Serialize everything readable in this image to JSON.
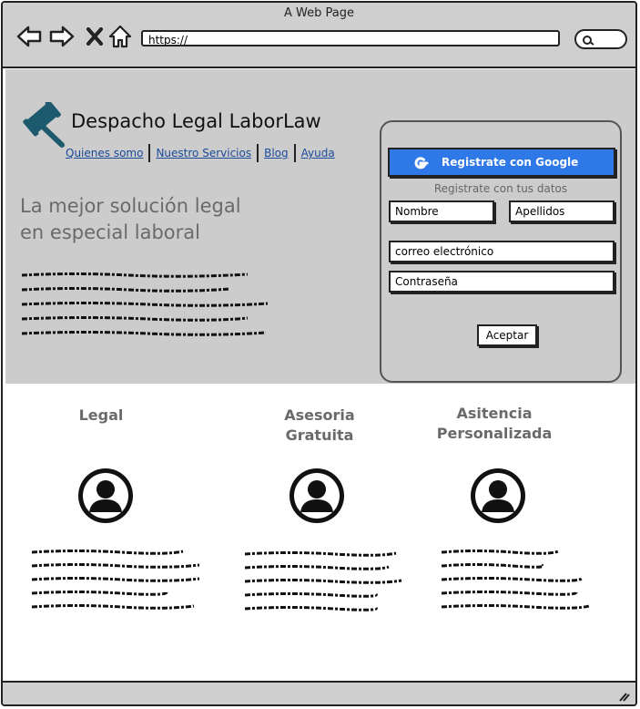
{
  "window": {
    "title": "A Web Page"
  },
  "browser": {
    "url": "https://",
    "icons": [
      "back-arrow-icon",
      "forward-arrow-icon",
      "close-x-icon",
      "home-icon",
      "search-icon"
    ]
  },
  "header": {
    "brand": "Despacho Legal LaborLaw",
    "logo_icon": "gavel-icon",
    "nav": [
      "Quienes somo",
      "Nuestro Servicios",
      "Blog",
      "Ayuda"
    ]
  },
  "hero": {
    "headline_line1": "La mejor solución legal",
    "headline_line2": "en especial laboral"
  },
  "signup": {
    "google_button": "Registrate con Google",
    "subtitle": "Registrate con tus datos",
    "first_name": "Nombre",
    "last_name": "Apellidos",
    "email": "correo electrónico",
    "password": "Contraseña",
    "submit": "Aceptar"
  },
  "features": [
    {
      "title_line1": "Legal",
      "title_line2": "",
      "icon": "user-avatar-icon"
    },
    {
      "title_line1": "Asesoria",
      "title_line2": "Gratuita",
      "icon": "user-avatar-icon"
    },
    {
      "title_line1": "Asitencia",
      "title_line2": "Personalizada",
      "icon": "user-avatar-icon"
    }
  ],
  "colors": {
    "accent": "#2f78e8",
    "hero_bg": "#cccccc",
    "link": "#1a4a9a",
    "chrome": "#cfcfcf"
  }
}
